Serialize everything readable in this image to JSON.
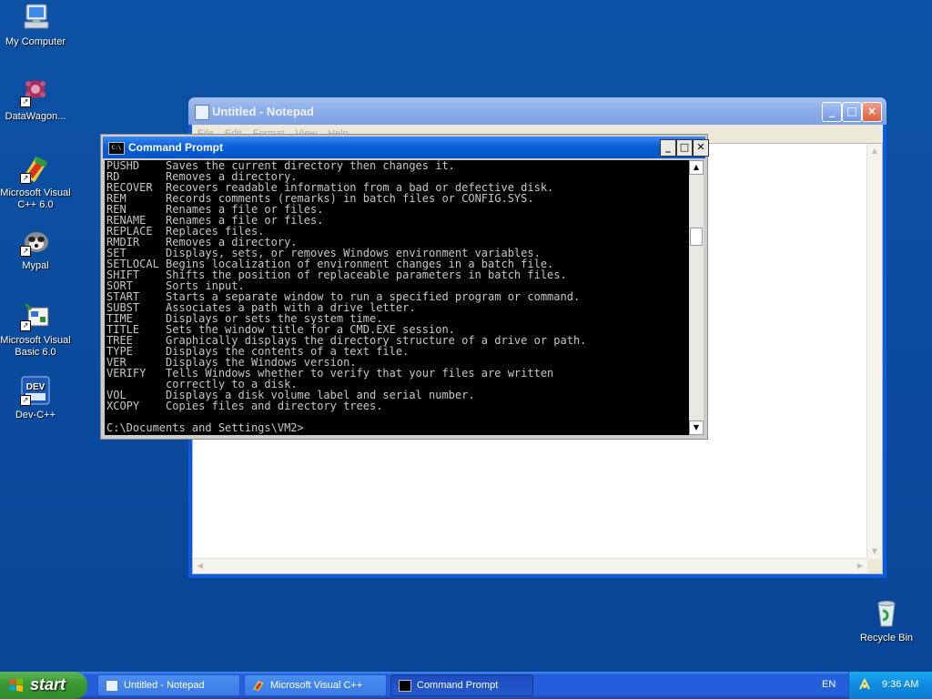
{
  "desktop": {
    "icons": [
      {
        "label": "My Computer",
        "icon": "computer-icon"
      },
      {
        "label": "DataWagon...",
        "icon": "datawagon-icon"
      },
      {
        "label": "Microsoft Visual C++ 6.0",
        "icon": "visual-cpp-icon"
      },
      {
        "label": "Mypal",
        "icon": "mypal-icon"
      },
      {
        "label": "Microsoft Visual Basic 6.0",
        "icon": "visual-basic-icon"
      },
      {
        "label": "Dev-C++",
        "icon": "devcpp-icon"
      },
      {
        "label": "Recycle Bin",
        "icon": "recycle-bin-icon"
      }
    ],
    "devcpp_badge": "DEV"
  },
  "notepad": {
    "title": "Untitled - Notepad",
    "menu": [
      "File",
      "Edit",
      "Format",
      "View",
      "Help"
    ],
    "content": ""
  },
  "cmd": {
    "title": "Command Prompt",
    "icon_text": "C:\\",
    "lines": [
      "PUSHD    Saves the current directory then changes it.",
      "RD       Removes a directory.",
      "RECOVER  Recovers readable information from a bad or defective disk.",
      "REM      Records comments (remarks) in batch files or CONFIG.SYS.",
      "REN      Renames a file or files.",
      "RENAME   Renames a file or files.",
      "REPLACE  Replaces files.",
      "RMDIR    Removes a directory.",
      "SET      Displays, sets, or removes Windows environment variables.",
      "SETLOCAL Begins localization of environment changes in a batch file.",
      "SHIFT    Shifts the position of replaceable parameters in batch files.",
      "SORT     Sorts input.",
      "START    Starts a separate window to run a specified program or command.",
      "SUBST    Associates a path with a drive letter.",
      "TIME     Displays or sets the system time.",
      "TITLE    Sets the window title for a CMD.EXE session.",
      "TREE     Graphically displays the directory structure of a drive or path.",
      "TYPE     Displays the contents of a text file.",
      "VER      Displays the Windows version.",
      "VERIFY   Tells Windows whether to verify that your files are written",
      "         correctly to a disk.",
      "VOL      Displays a disk volume label and serial number.",
      "XCOPY    Copies files and directory trees.",
      "",
      "C:\\Documents and Settings\\VM2>"
    ]
  },
  "taskbar": {
    "start_label": "start",
    "tasks": [
      {
        "label": "Untitled - Notepad",
        "icon": "notepad-icon",
        "active": false
      },
      {
        "label": "Microsoft Visual C++",
        "icon": "visual-cpp-icon",
        "active": false
      },
      {
        "label": "Command Prompt",
        "icon": "cmd-icon",
        "active": true
      }
    ],
    "language": "EN",
    "clock": "9:36 AM"
  },
  "colors": {
    "desktop": "#0b4e9f",
    "console_bg": "#000000",
    "console_fg": "#c8c8c8",
    "taskbar": "#245edb",
    "start": "#3c9a37"
  }
}
